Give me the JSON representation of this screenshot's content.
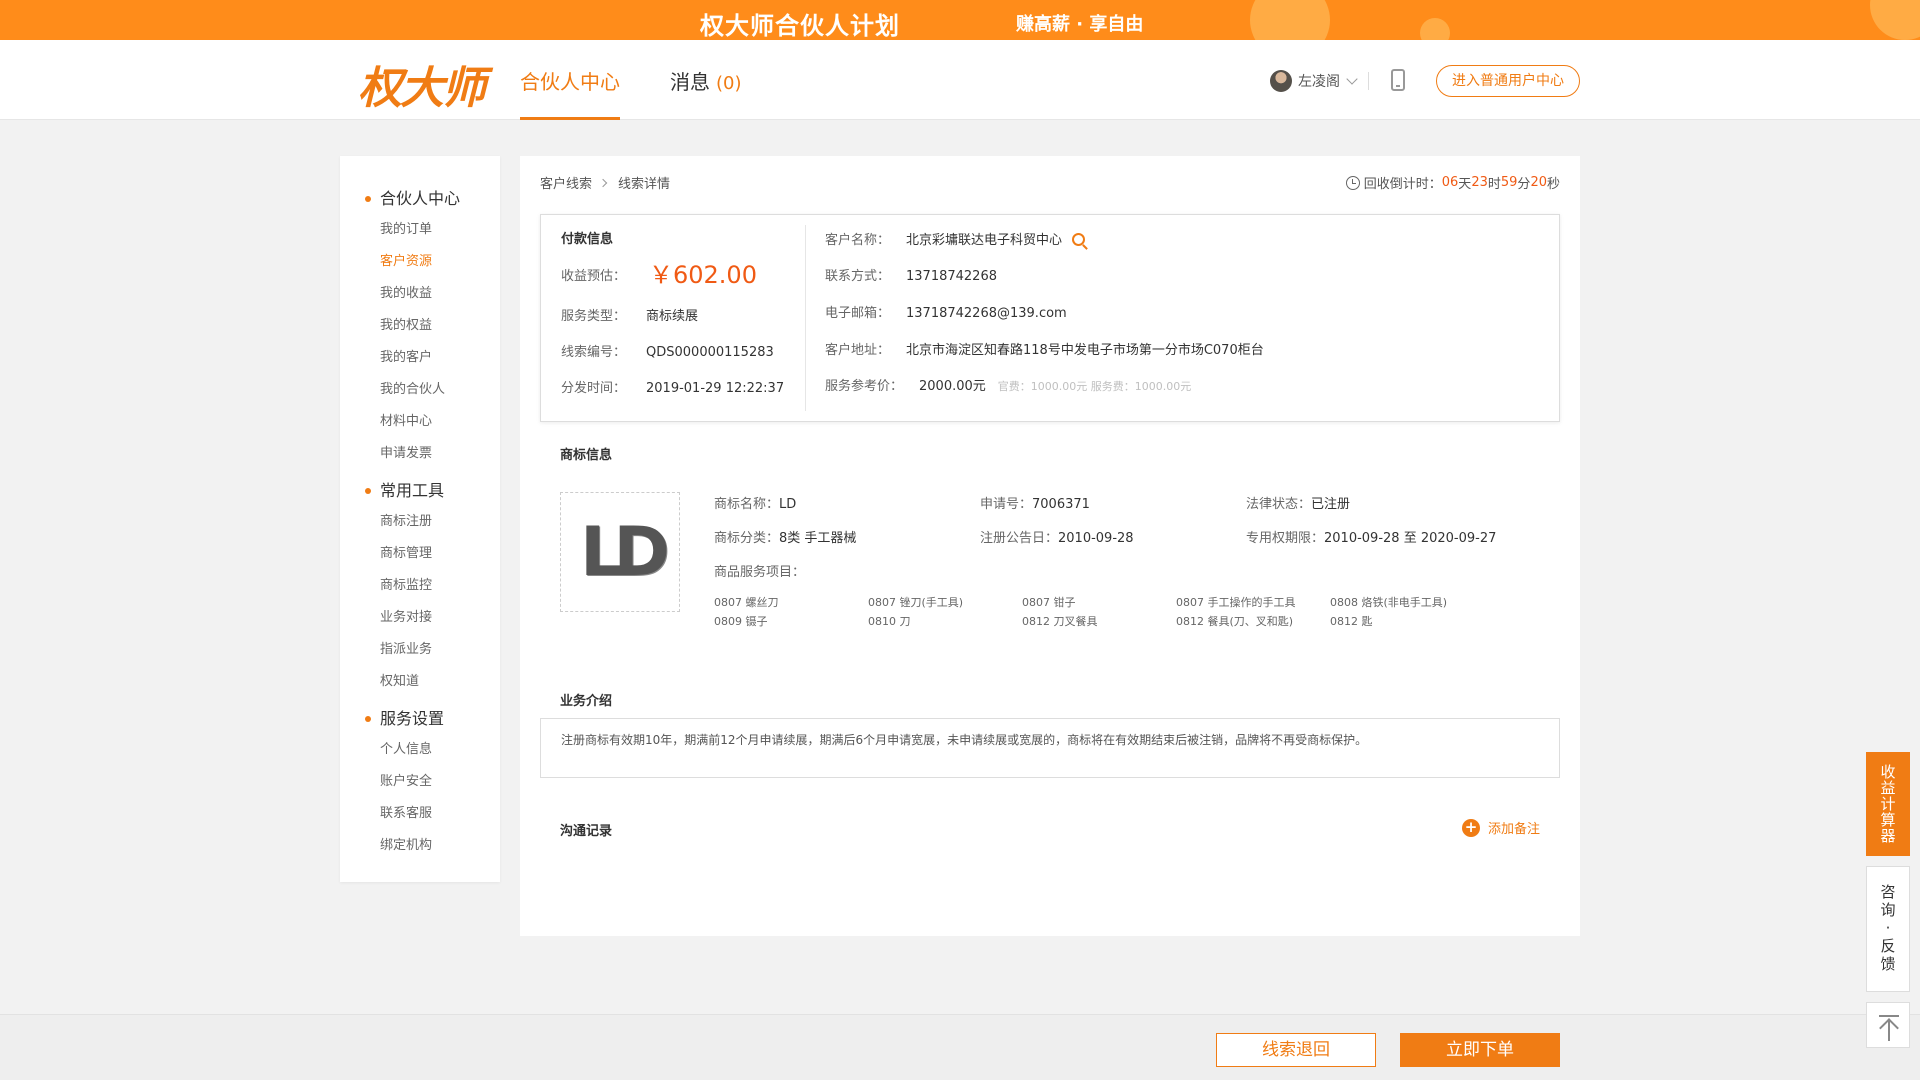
{
  "banner": {
    "title": "权大师合伙人计划",
    "slogan": "赚高薪 · 享自由"
  },
  "header": {
    "logo": "权大师",
    "nav": [
      {
        "label": "合伙人中心",
        "active": true
      },
      {
        "label": "消息",
        "count": "(0)",
        "active": false
      }
    ],
    "user_name": "左凌阁",
    "enter_button": "进入普通用户中心"
  },
  "sidebar": {
    "groups": [
      {
        "title": "合伙人中心",
        "items": [
          "我的订单",
          "客户资源",
          "我的收益",
          "我的权益",
          "我的客户",
          "我的合伙人",
          "材料中心",
          "申请发票"
        ]
      },
      {
        "title": "常用工具",
        "items": [
          "商标注册",
          "商标管理",
          "商标监控",
          "业务对接",
          "指派业务",
          "权知道"
        ]
      },
      {
        "title": "服务设置",
        "items": [
          "个人信息",
          "账户安全",
          "联系客服",
          "绑定机构"
        ]
      }
    ],
    "active_item": "客户资源"
  },
  "breadcrumb": {
    "root": "客户线索",
    "current": "线索详情"
  },
  "countdown": {
    "label": "回收倒计时：",
    "days": "06",
    "d_unit": "天",
    "hours": "23",
    "h_unit": "时",
    "minutes": "59",
    "m_unit": "分",
    "seconds": "20",
    "s_unit": "秒"
  },
  "payment": {
    "title": "付款信息",
    "income_label": "收益预估：",
    "income_value": "￥602.00",
    "service_type_label": "服务类型：",
    "service_type_value": "商标续展",
    "lead_no_label": "线索编号：",
    "lead_no_value": "QDS000000115283",
    "dispatch_time_label": "分发时间：",
    "dispatch_time_value": "2019-01-29 12:22:37"
  },
  "customer": {
    "name_label": "客户名称：",
    "name_value": "北京彩墉联达电子科贸中心",
    "contact_label": "联系方式：",
    "contact_value": "13718742268",
    "email_label": "电子邮箱：",
    "email_value": "13718742268@139.com",
    "address_label": "客户地址：",
    "address_value": "北京市海淀区知春路118号中发电子市场第一分市场C070柜台",
    "ref_price_label": "服务参考价：",
    "ref_price_value": "2000.00元",
    "ref_price_detail": "官费：1000.00元 服务费：1000.00元"
  },
  "trademark": {
    "title": "商标信息",
    "logo_text": "LD",
    "name_label": "商标名称：",
    "name_value": "LD",
    "app_no_label": "申请号：",
    "app_no_value": "7006371",
    "status_label": "法律状态：",
    "status_value": "已注册",
    "class_label": "商标分类：",
    "class_value": "8类 手工器械",
    "announce_label": "注册公告日：",
    "announce_value": "2010-09-28",
    "term_label": "专用权期限：",
    "term_value": "2010-09-28 至 2020-09-27",
    "goods_label": "商品服务项目：",
    "goods": [
      "0807 螺丝刀",
      "0807 锉刀(手工具)",
      "0807 钳子",
      "0807 手工操作的手工具",
      "0808 烙铁(非电手工具)",
      "0809 镊子",
      "0810 刀",
      "0812 刀叉餐具",
      "0812 餐具(刀、叉和匙)",
      "0812 匙"
    ]
  },
  "business": {
    "title": "业务介绍",
    "text": "注册商标有效期10年，期满前12个月申请续展，期满后6个月申请宽展，未申请续展或宽展的，商标将在有效期结束后被注销，品牌将不再受商标保护。"
  },
  "communication": {
    "title": "沟通记录",
    "add_note": "添加备注"
  },
  "actions": {
    "return_label": "线索退回",
    "order_label": "立即下单"
  },
  "floating": {
    "calc": [
      "收",
      "益",
      "计",
      "算",
      "器"
    ],
    "consult": [
      "咨",
      "询",
      "·",
      "反",
      "馈"
    ]
  },
  "colors": {
    "accent": "#f07c14",
    "banner": "#ff8c1a",
    "price": "#f05a14"
  },
  "icons": [
    "search-icon",
    "clock-icon",
    "phone-icon",
    "plus-icon",
    "back-to-top-icon"
  ]
}
